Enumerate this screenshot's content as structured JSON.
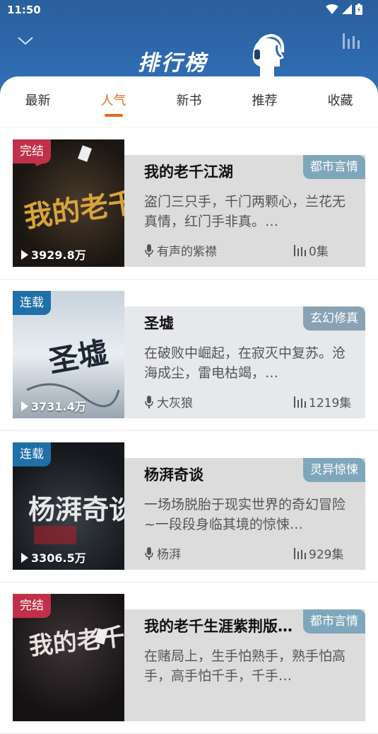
{
  "status": {
    "time": "11:50"
  },
  "header": {
    "title": "排行榜"
  },
  "tabs": [
    {
      "label": "最新",
      "active": false
    },
    {
      "label": "人气",
      "active": true
    },
    {
      "label": "新书",
      "active": false
    },
    {
      "label": "推荐",
      "active": false
    },
    {
      "label": "收藏",
      "active": false
    }
  ],
  "books": [
    {
      "status": "完结",
      "status_type": "done",
      "plays": "3929.8万",
      "title": "我的老千江湖",
      "category": "都市言情",
      "desc": "盗门三只手，千门两颗心，兰花无真情，红门手非真。…",
      "narrator": "有声的紫襟",
      "episodes": "0集",
      "cover_text": "我的老千江湖"
    },
    {
      "status": "连载",
      "status_type": "serial",
      "plays": "3731.4万",
      "title": "圣墟",
      "category": "玄幻修真",
      "desc": "在破败中崛起，在寂灭中复苏。沧海成尘，雷电枯竭，…",
      "narrator": "大灰狼",
      "episodes": "1219集",
      "cover_text": "圣墟"
    },
    {
      "status": "连载",
      "status_type": "serial",
      "plays": "3306.5万",
      "title": "杨湃奇谈",
      "category": "灵异惊悚",
      "desc": "一场场脱胎于现实世界的奇幻冒险~一段段身临其境的惊悚…",
      "narrator": "杨湃",
      "episodes": "929集",
      "cover_text": "杨湃奇谈"
    },
    {
      "status": "完结",
      "status_type": "done",
      "plays": "",
      "title": "我的老千生涯紫荆版…",
      "category": "都市言情",
      "desc": "在赌局上，生手怕熟手，熟手怕高手，高手怕千手，千手…",
      "narrator": "",
      "episodes": "",
      "cover_text": "我的老千生涯"
    }
  ],
  "colors": {
    "header_bg": "#2f6bb0",
    "accent": "#e9671c",
    "badge_done": "#c0304a",
    "badge_serial": "#1f6fa8",
    "category_bg": "#7fa7bb"
  },
  "icons": [
    "wifi-icon",
    "signal-icon",
    "battery-icon",
    "chevron-down-icon",
    "headset-icon",
    "bar-chart-icon",
    "play-icon",
    "mic-icon",
    "episodes-icon"
  ]
}
